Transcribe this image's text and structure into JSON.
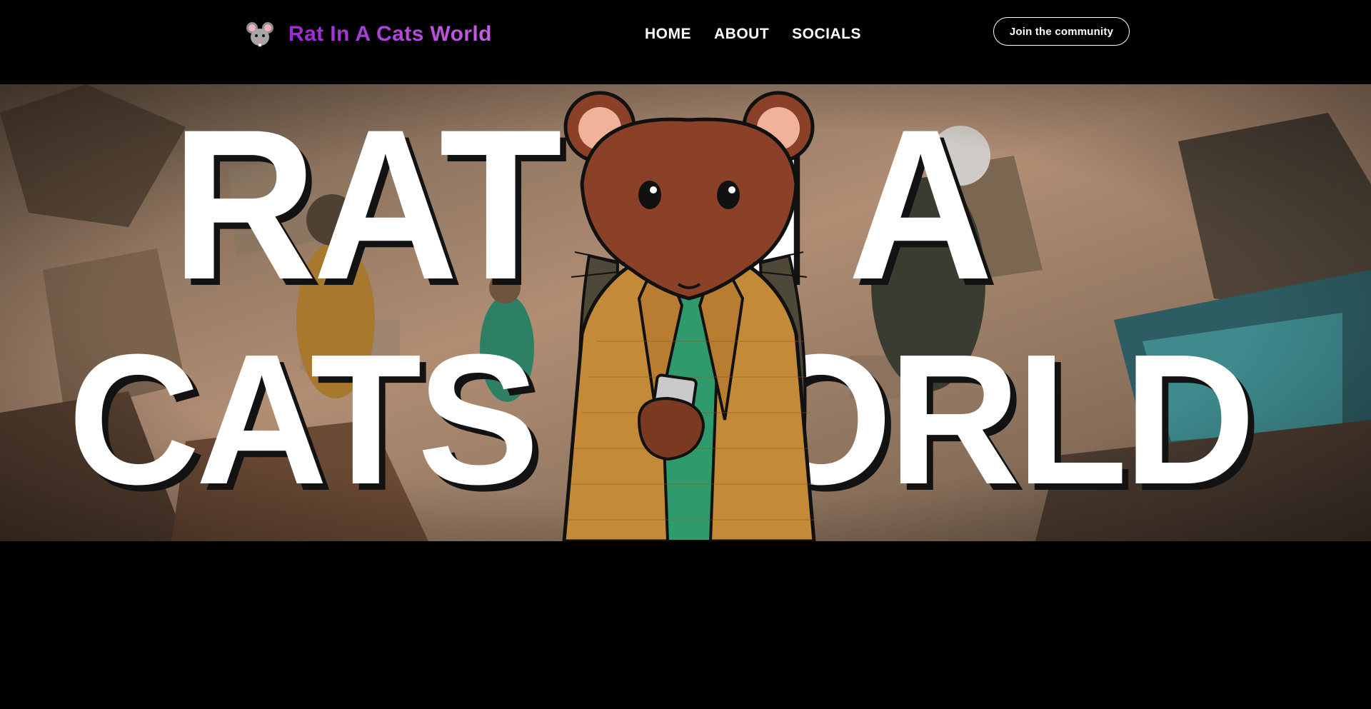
{
  "header": {
    "brand_name": "Rat In A Cats World",
    "brand_icon": "rat-face-icon",
    "nav": [
      {
        "label": "HOME"
      },
      {
        "label": "ABOUT"
      },
      {
        "label": "SOCIALS"
      }
    ],
    "join_button": "Join the community"
  },
  "hero": {
    "title_line1": "RAT IN A",
    "title_line2": "CATS WORLD",
    "illustration": "rat-in-jacket-holding-phone-illustration"
  },
  "colors": {
    "background": "#000000",
    "brand_gradient_start": "#9a2bd0",
    "brand_gradient_end": "#c65ee3",
    "title_text": "#ffffff",
    "rat_fur": "#8a4128",
    "jacket": "#c48a38",
    "shirt": "#2f9a6c"
  }
}
